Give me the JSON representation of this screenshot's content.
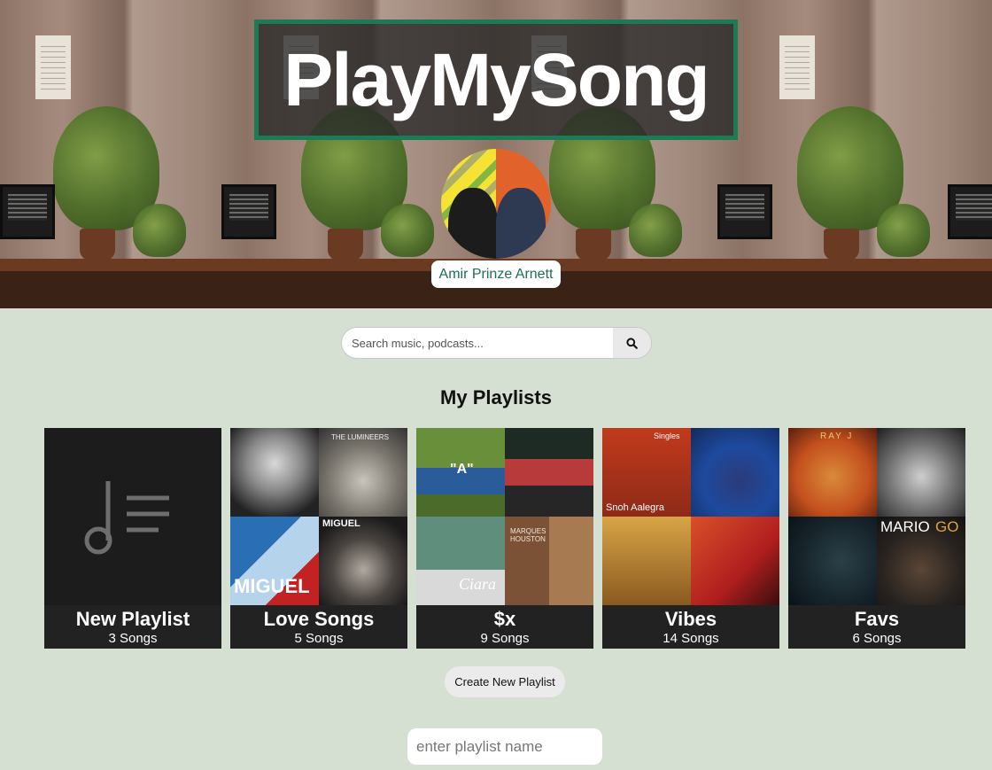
{
  "header": {
    "title": "PlayMySong",
    "user_name": "Amir Prinze Arnett"
  },
  "search": {
    "placeholder": "Search music, podcasts...",
    "icon": "search-icon"
  },
  "playlists_section": {
    "heading": "My Playlists",
    "playlists": [
      {
        "name": "New Playlist",
        "count": "3 Songs",
        "art": "music-note-list-icon"
      },
      {
        "name": "Love Songs",
        "count": "5 Songs"
      },
      {
        "name": "$x",
        "count": "9 Songs"
      },
      {
        "name": "Vibes",
        "count": "14 Songs"
      },
      {
        "name": "Favs",
        "count": "6 Songs"
      }
    ],
    "create_button_label": "Create New Playlist",
    "playlist_name_placeholder": "enter playlist name"
  },
  "album_art_text": {
    "love_songs_miguel": "MIGUEL",
    "love_songs_lumineers": "THE LUMINEERS",
    "sx_a": "\"A\"",
    "sx_ciara": "Ciara",
    "sx_marques": "MARQUES HOUSTON",
    "vibes_snoh": "Snoh Aalegra",
    "vibes_singles": "Singles",
    "favs_rayj": "RAY J",
    "favs_mario": "MARIO",
    "favs_go": "GO"
  },
  "colors": {
    "background": "#d5dfd2",
    "title_border": "#1c7a55",
    "name_text": "#1e6e52",
    "card_bg": "#222222"
  }
}
